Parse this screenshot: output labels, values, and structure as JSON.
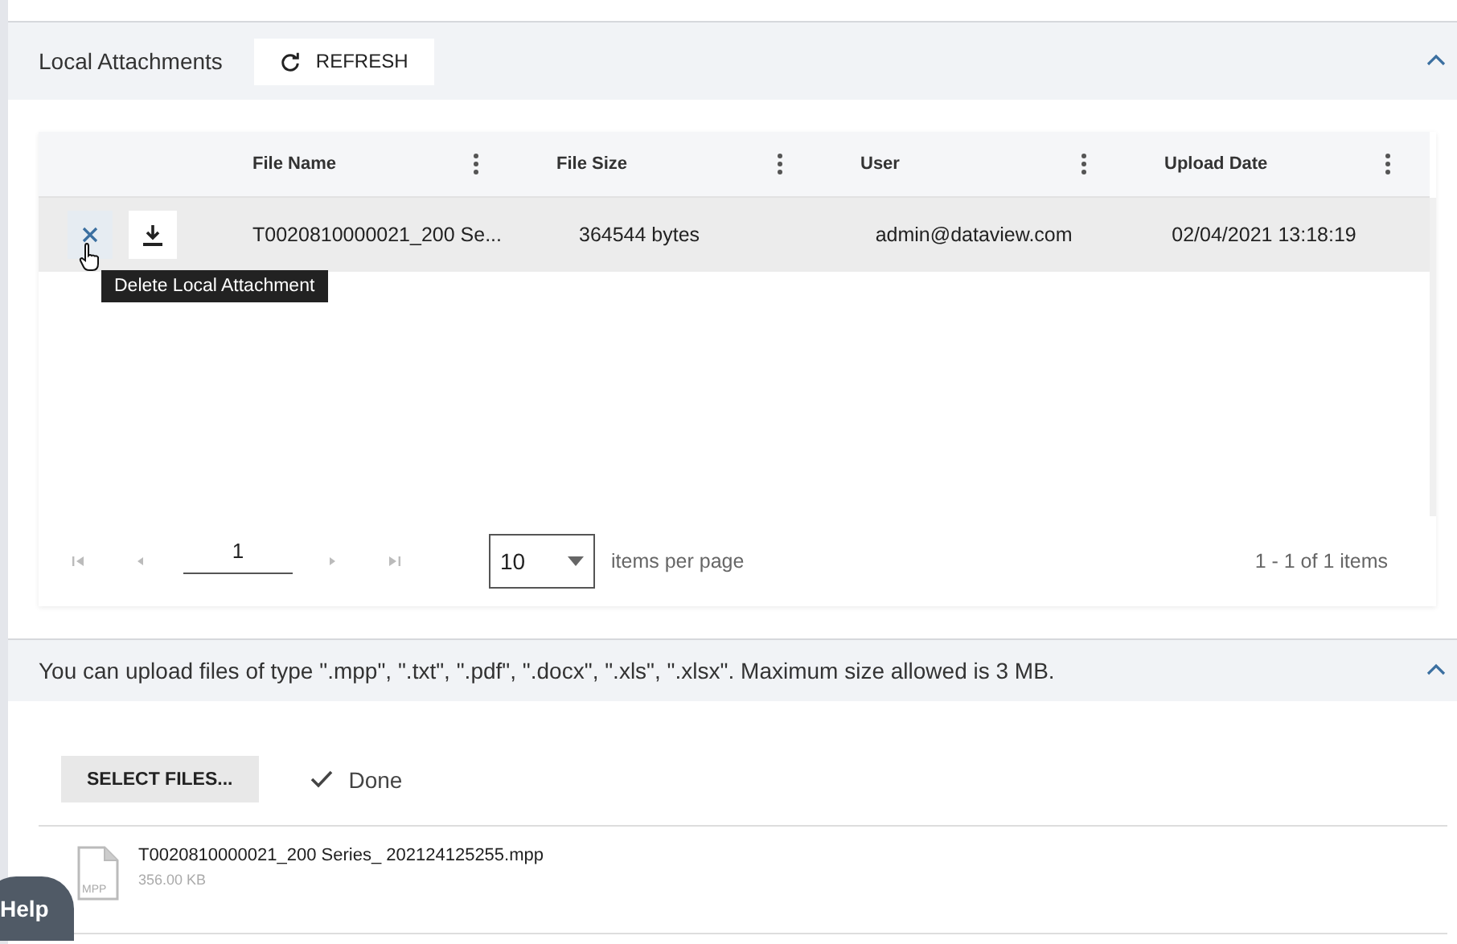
{
  "attachments_panel": {
    "title": "Local Attachments",
    "refresh_button": "REFRESH",
    "expanded": true
  },
  "grid": {
    "columns": [
      "File Name",
      "File Size",
      "User",
      "Upload Date"
    ],
    "rows": [
      {
        "file_name": "T0020810000021_200 Se...",
        "file_size": "364544 bytes",
        "user": "admin@dataview.com",
        "upload_date": "02/04/2021 13:18:19",
        "highlighted": true
      }
    ],
    "tooltip": "Delete Local Attachment",
    "pager": {
      "page": "1",
      "page_size": "10",
      "page_size_label": "items per page",
      "summary": "1 - 1 of 1 items"
    }
  },
  "upload_panel": {
    "title": "You can upload files of type \".mpp\", \".txt\", \".pdf\", \".docx\", \".xls\", \".xlsx\". Maximum size allowed is 3 MB.",
    "expanded": true,
    "select_button": "SELECT FILES...",
    "status": "Done",
    "files": [
      {
        "name": "T0020810000021_200 Series_ 202124125255.mpp",
        "size": "356.00 KB",
        "type_label": "MPP"
      }
    ]
  },
  "help_button": "Help"
}
